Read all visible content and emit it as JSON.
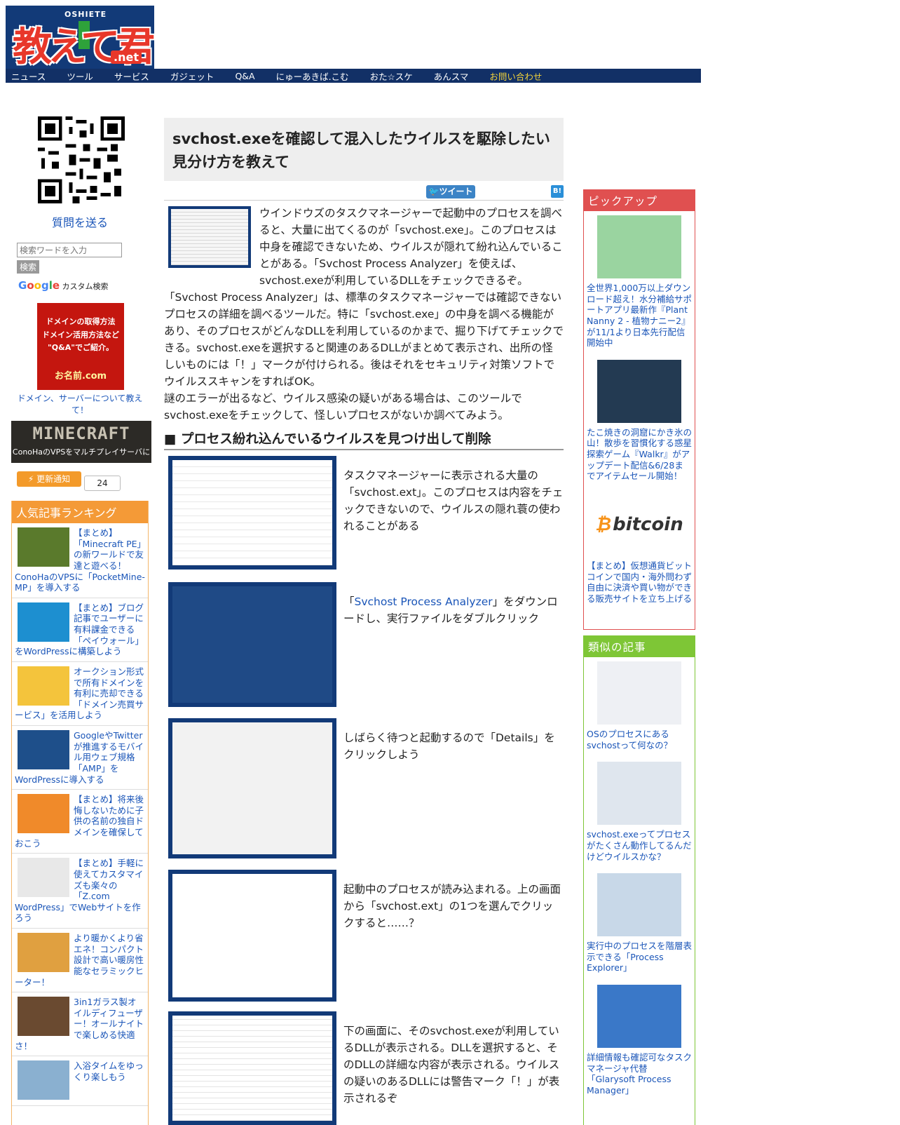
{
  "header": {
    "logo_top": "OSHIETE",
    "logo_text": "教えて君",
    "logo_net": ".net",
    "nav": [
      "ニュース",
      "ツール",
      "サービス",
      "ガジェット",
      "Q&A",
      "にゅーあきば.こむ",
      "おた☆スケ",
      "あんスマ",
      "お問い合わせ"
    ]
  },
  "left": {
    "send_question": "質問を送る",
    "search_placeholder": "検索ワードを入力",
    "search_button": "検索",
    "google_label": "Google",
    "custom_search": "カスタム検索",
    "ad_lines": [
      "ドメインの取得方法",
      "ドメイン活用方法など",
      "\"Q&A\"でご紹介。"
    ],
    "ad_brand": "お名前.com",
    "ad_caption": "ドメイン、サーバーについて教えて！",
    "mc_title": "MINECRAFT",
    "mc_subtitle": "ConoHaのVPSをマルチプレイサーバに",
    "update_button": "更新通知",
    "update_count": "24",
    "ranking_title": "人気記事ランキング",
    "ranking": [
      {
        "text": "【まとめ】「Minecraft PE」の新ワールドで友達と遊べる！ConoHaのVPSに「PocketMine-MP」を導入する",
        "color": "#5a7a2c"
      },
      {
        "text": "【まとめ】ブログ記事でユーザーに有料課金できる「ペイウォール」をWordPressに構築しよう",
        "color": "#1d8fd0"
      },
      {
        "text": "オークション形式で所有ドメインを有利に売却できる「ドメイン売買サービス」を活用しよう",
        "color": "#f4c43c"
      },
      {
        "text": "GoogleやTwitterが推進するモバイル用ウェブ規格「AMP」をWordPressに導入する",
        "color": "#1e4f8a"
      },
      {
        "text": "【まとめ】将来後悔しないために子供の名前の独自ドメインを確保しておこう",
        "color": "#f08a2a"
      },
      {
        "text": "【まとめ】手軽に使えてカスタマイズも楽々の「Z.com WordPress」でWebサイトを作ろう",
        "color": "#e8e8e8"
      },
      {
        "text": "より暖かくより省エネ！コンパクト設計で高い暖房性能なセラミックヒーター！",
        "color": "#e0a040"
      },
      {
        "text": "3in1ガラス製オイルディフューザー！オールナイトで楽しめる快適さ！",
        "color": "#6a4a30"
      },
      {
        "text": "入浴タイムをゆっくり楽しもう",
        "color": "#8ab0d0"
      }
    ]
  },
  "article": {
    "title": "svchost.exeを確認して混入したウイルスを駆除したい 見分け方を教えて",
    "tweet": "ツイート",
    "hatena": "B!",
    "lead1": "ウインドウズのタスクマネージャーで起動中のプロセスを調べると、大量に出てくるのが「svchost.exe」。このプロセスは中身を確認できないため、ウイルスが隠れて紛れ込んでいることがある。「Svchost Process Analyzer」を使えば、svchost.exeが利用しているDLLをチェックできるぞ。",
    "lead2": "「Svchost Process Analyzer」は、標準のタスクマネージャーでは確認できないプロセスの詳細を調べるツールだ。特に「svchost.exe」の中身を調べる機能があり、そのプロセスがどんなDLLを利用しているのかまで、掘り下げてチェックできる。svchost.exeを選択すると関連のあるDLLがまとめて表示され、出所の怪しいものには「！」マークが付けられる。後はそれをセキュリティ対策ソフトでウイルススキャンをすればOK。",
    "lead3": "謎のエラーが出るなど、ウイルス感染の疑いがある場合は、このツールでsvchost.exeをチェックして、怪しいプロセスがないか調べてみよう。",
    "section": "■ プロセス紛れ込んでいるウイルスを見つけ出して削除",
    "steps": [
      "タスクマネージャーに表示される大量の「svchost.ext」。このプロセスは内容をチェックできないので、ウイルスの隠れ蓑の使われることがある",
      "「Svchost Process Analyzer」をダウンロードし、実行ファイルをダブルクリック",
      "しばらく待つと起動するので「Details」をクリックしよう",
      "起動中のプロセスが読み込まれる。上の画面から「svchost.ext」の1つを選んでクリックすると……？",
      "下の画面に、そのsvchost.exeが利用しているDLLが表示される。DLLを選択すると、そのDLLの詳細な内容が表示される。ウイルスの疑いのあるDLLには警告マーク「！」が表示されるぞ"
    ],
    "step2_link": "Svchost Process Analyzer"
  },
  "right": {
    "pickup_title": "ピックアップ",
    "pickup_color": "#e05050",
    "pickup": [
      "全世界1,000万以上ダウンロード超え！水分補給サポートアプリ最新作『Plant Nanny 2 - 植物ナニー2』が11/1より日本先行配信開始中",
      "たこ焼きの洞窟にかき氷の山！散歩を習慣化する惑星探索ゲーム『Walkr』がアップデート配信&6/28までアイテムセール開始！",
      "【まとめ】仮想通貨ビットコインで国内・海外問わず自由に決済や買い物ができる販売サイトを立ち上げる"
    ],
    "bitcoin_logo": "bitcoin",
    "similar_title": "類似の記事",
    "similar_color": "#7ec636",
    "similar": [
      "OSのプロセスにあるsvchostって何なの？",
      "svchost.exeってプロセスがたくさん動作してるんだけどウイルスかな？",
      "実行中のプロセスを階層表示できる「Process Explorer」",
      "詳細情報も確認可なタスクマネージャ代替「Glarysoft Process Manager」"
    ]
  }
}
